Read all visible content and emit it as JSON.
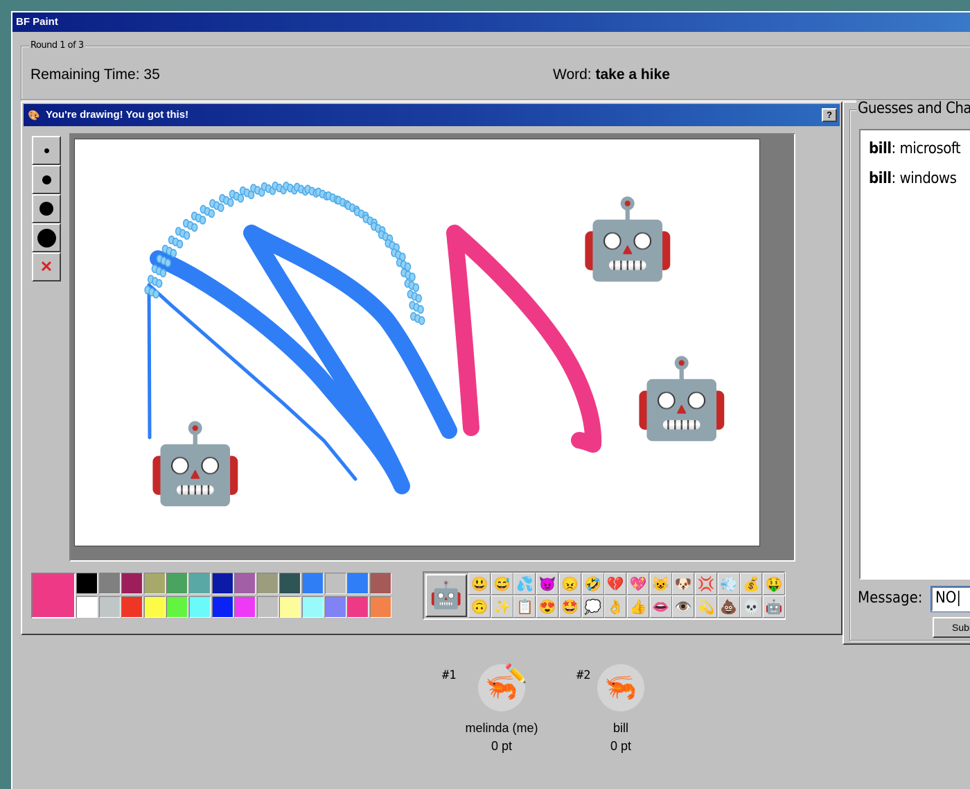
{
  "window": {
    "title": "BF Paint"
  },
  "round": {
    "legend": "Round 1 of 3",
    "remaining_label": "Remaining Time: ",
    "remaining_value": "35",
    "word_label": "Word: ",
    "word_value": "take a hike"
  },
  "drawing_panel": {
    "title": "You're drawing! You got this!",
    "help_label": "?",
    "tools": [
      {
        "name": "brush-size-1"
      },
      {
        "name": "brush-size-2"
      },
      {
        "name": "brush-size-3"
      },
      {
        "name": "brush-size-4"
      },
      {
        "name": "clear",
        "label": "✕"
      }
    ],
    "current_color": "#ee3a86",
    "palette_row1": [
      "#000000",
      "#808080",
      "#9c1f5b",
      "#a6a96a",
      "#4aa35f",
      "#5aa8a6",
      "#0c1aa8",
      "#a35fa5",
      "#9c9d7d",
      "#2f5456",
      "#2f7ef6",
      "#c0c0c0",
      "#2f7ef6",
      "#a65a58"
    ],
    "palette_row2": [
      "#ffffff",
      "#c0c6c6",
      "#ee3526",
      "#fcfc47",
      "#62f440",
      "#6afafa",
      "#0a22f6",
      "#ee3af6",
      "#c0c0c0",
      "#fcfc9a",
      "#98fafa",
      "#8082f6",
      "#ee3a86",
      "#f2814a"
    ],
    "selected_emoji": "🤖",
    "emoji_row1": [
      "😃",
      "😅",
      "💦",
      "😈",
      "😠",
      "🤣",
      "💔",
      "💖",
      "😺",
      "🐶",
      "💢",
      "💨",
      "💰",
      "🤑"
    ],
    "emoji_row2": [
      "🙃",
      "✨",
      "📋",
      "😍",
      "🤩",
      "💭",
      "👌",
      "👍",
      "👄",
      "👁️",
      "💫",
      "💩",
      "💀",
      "🤖"
    ],
    "canvas_robots": [
      "🤖",
      "🤖",
      "🤖"
    ]
  },
  "chat": {
    "legend": "Guesses and Chat",
    "messages": [
      {
        "user": "bill",
        "text": "microsoft"
      },
      {
        "user": "bill",
        "text": "windows"
      }
    ],
    "message_label": "Message:",
    "message_value": "NO",
    "submit_label": "Submit"
  },
  "players": [
    {
      "rank": "#1",
      "name": "melinda (me)",
      "score": "0 pt",
      "avatar": "🦐"
    },
    {
      "rank": "#2",
      "name": "bill",
      "score": "0 pt",
      "avatar": "🦐"
    }
  ]
}
